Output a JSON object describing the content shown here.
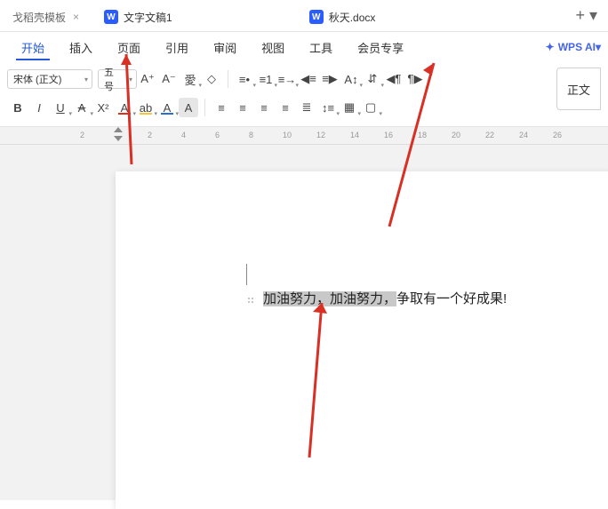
{
  "tabs": {
    "template": "戈稻壳模板",
    "doc1": "文字文稿1",
    "doc2": "秋天.docx"
  },
  "menus": {
    "start": "开始",
    "insert": "插入",
    "page": "页面",
    "ref": "引用",
    "review": "审阅",
    "view": "视图",
    "tools": "工具",
    "member": "会员专享",
    "ai": "WPS AI"
  },
  "toolbar": {
    "font_name": "宋体 (正文)",
    "font_size": "五号",
    "right_button": "正文"
  },
  "ruler": {
    "marks": [
      "2",
      "4",
      "6",
      "8",
      "10",
      "12",
      "14",
      "16",
      "18",
      "20",
      "22",
      "24",
      "26"
    ],
    "neg": [
      "2"
    ]
  },
  "document": {
    "selected_text": "加油努力，加油努力，",
    "rest_text": "争取有一个好成果!"
  }
}
